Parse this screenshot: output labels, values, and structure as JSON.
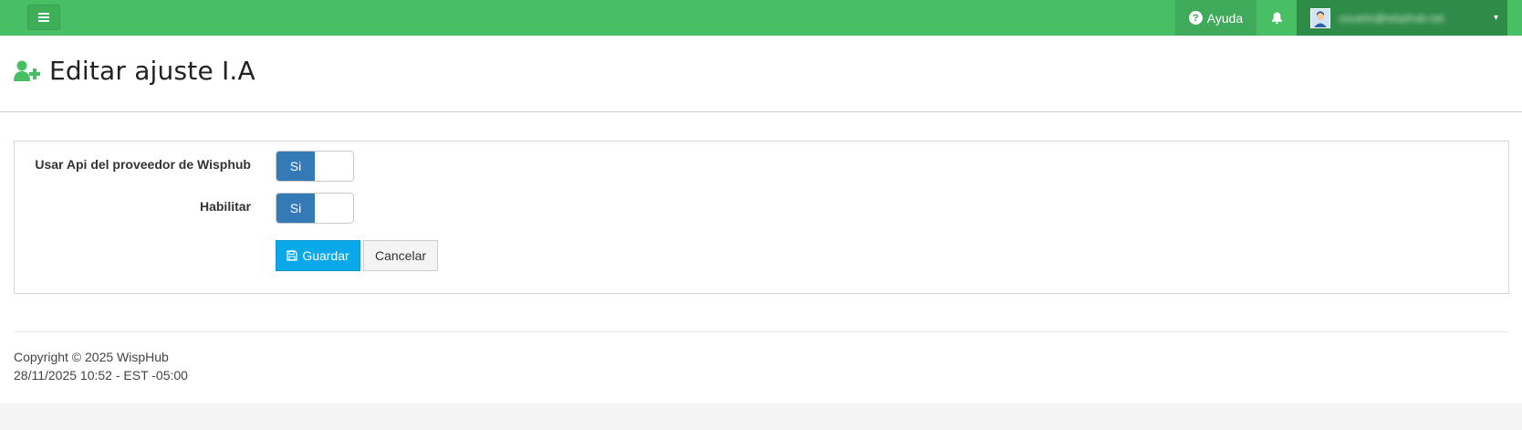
{
  "topbar": {
    "help_label": "Ayuda",
    "user_email": "usuario@wisphub.net"
  },
  "icons": {
    "menu": "hamburger-menu-icon",
    "help": "question-circle-icon",
    "notifications": "bell-icon",
    "user": "user-avatar-icon",
    "page": "user-plus-icon",
    "save": "floppy-disk-icon"
  },
  "page": {
    "title": "Editar ajuste I.A"
  },
  "form": {
    "fields": [
      {
        "label": "Usar Api del proveedor de Wisphub",
        "value": "Si"
      },
      {
        "label": "Habilitar",
        "value": "Si"
      }
    ],
    "save_label": "Guardar",
    "cancel_label": "Cancelar"
  },
  "footer": {
    "copyright": "Copyright © 2025 WispHub",
    "datetime": "28/11/2025 10:52 - EST -05:00"
  },
  "colors": {
    "topbar": "#48bf64",
    "toggle_on": "#337ab7",
    "save_button": "#0aa8e8",
    "page_icon": "#48bf64"
  }
}
